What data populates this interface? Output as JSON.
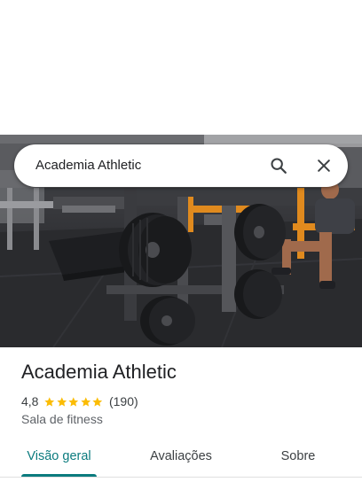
{
  "search": {
    "query": "Academia Athletic",
    "search_icon": "search-icon",
    "close_icon": "close-icon"
  },
  "place": {
    "name": "Academia Athletic",
    "rating": "4,8",
    "stars_filled": 5,
    "reviews": "(190)",
    "category": "Sala de fitness"
  },
  "tabs": [
    {
      "label": "Visão geral",
      "active": true
    },
    {
      "label": "Avaliações",
      "active": false
    },
    {
      "label": "Sobre",
      "active": false
    }
  ],
  "colors": {
    "accent": "#0b7b7e",
    "star": "#fbbc04",
    "text_primary": "#202124",
    "text_secondary": "#5f6368"
  }
}
